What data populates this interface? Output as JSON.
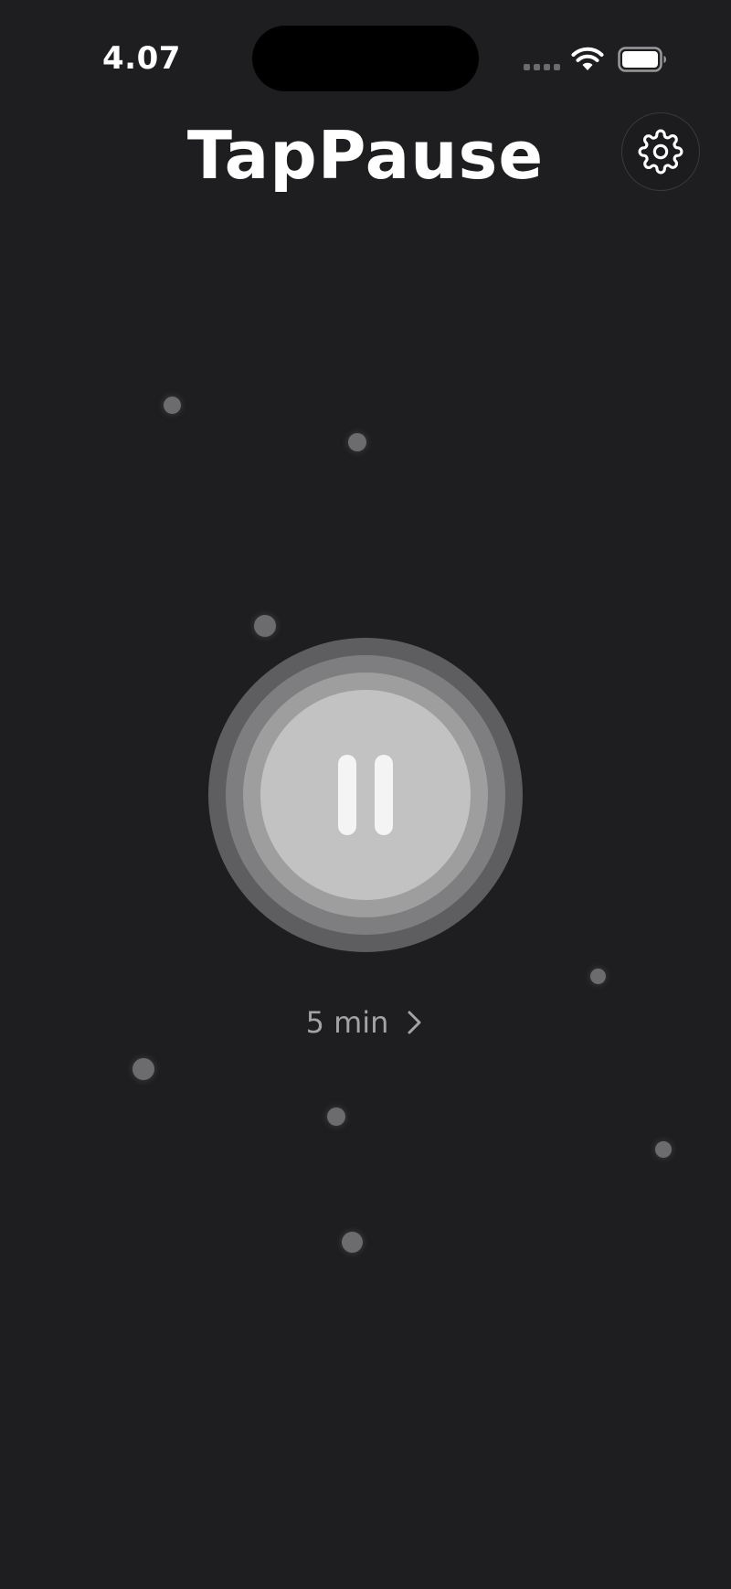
{
  "status_bar": {
    "time": "4.07",
    "icons": [
      "cellular-dots-icon",
      "wifi-icon",
      "battery-icon"
    ]
  },
  "header": {
    "title": "TapPause",
    "settings_icon": "gear-icon"
  },
  "main": {
    "pause_button": {
      "icon": "pause-icon",
      "colors": {
        "ring_outer": "#5e5e60",
        "ring_middle": "#7e7e80",
        "ring_inner": "#9e9e9f",
        "center": "#c2c2c3",
        "bars": "#f4f4f5"
      }
    },
    "duration": {
      "label": "5 min",
      "icon": "chevron-right-icon"
    }
  },
  "theme": {
    "background": "#1e1e20",
    "text_primary": "#ffffff",
    "text_secondary": "#a3a3a6",
    "dot_color": "#6c6c6f"
  }
}
